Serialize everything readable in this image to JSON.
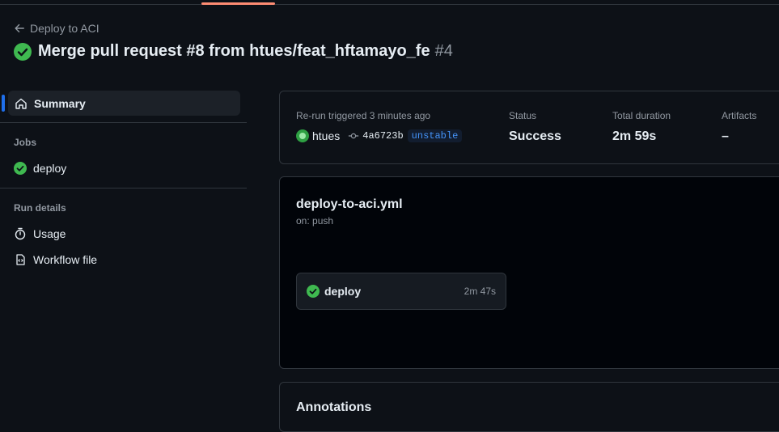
{
  "header": {
    "back_label": "Deploy to ACI",
    "run_title": "Merge pull request #8 from htues/feat_hftamayo_fe",
    "run_number": "#4"
  },
  "sidebar": {
    "summary_label": "Summary",
    "jobs_heading": "Jobs",
    "jobs": [
      {
        "label": "deploy",
        "status": "success"
      }
    ],
    "run_details_heading": "Run details",
    "usage_label": "Usage",
    "workflow_file_label": "Workflow file"
  },
  "summary": {
    "trigger_text": "Re-run triggered 3 minutes ago",
    "actor": "htues",
    "commit_sha": "4a6723b",
    "branch_badge": "unstable",
    "status_label": "Status",
    "status_value": "Success",
    "duration_label": "Total duration",
    "duration_value": "2m 59s",
    "artifacts_label": "Artifacts",
    "artifacts_value": "–"
  },
  "workflow": {
    "file_name": "deploy-to-aci.yml",
    "trigger": "on: push",
    "job": {
      "name": "deploy",
      "duration": "2m 47s",
      "status": "success"
    }
  },
  "annotations": {
    "title": "Annotations"
  },
  "colors": {
    "success": "#3fb950",
    "accent": "#1f6feb",
    "tab_underline": "#fd8c73",
    "background": "#0d1117"
  },
  "icons": [
    "arrow-left-icon",
    "check-circle-icon",
    "home-icon",
    "stopwatch-icon",
    "workflow-file-icon",
    "commit-icon"
  ]
}
